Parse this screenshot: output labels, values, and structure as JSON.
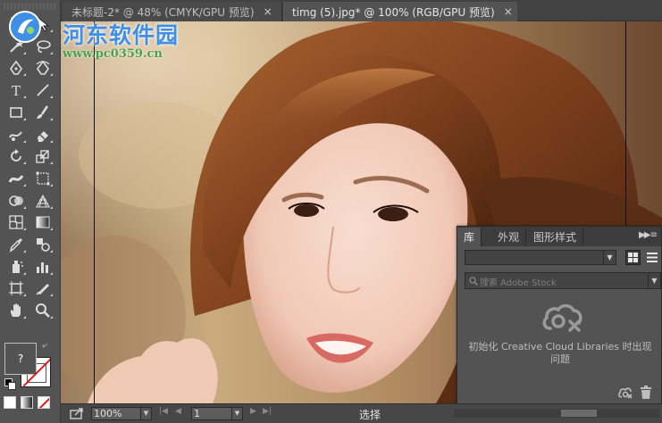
{
  "tabs": [
    {
      "label": "未标题-2* @ 48% (CMYK/GPU 预览)",
      "active": false
    },
    {
      "label": "timg (5).jpg* @ 100% (RGB/GPU 预览)",
      "active": true
    }
  ],
  "tab_close_glyph": "×",
  "watermark": {
    "title": "河东软件园",
    "url": "www.pc0359.cn"
  },
  "tools": [
    "selection-tool",
    "direct-selection-tool",
    "magic-wand-tool",
    "lasso-tool",
    "pen-tool",
    "curvature-tool",
    "type-tool",
    "line-tool",
    "rectangle-tool",
    "paintbrush-tool",
    "shaper-tool",
    "eraser-tool",
    "rotate-tool",
    "scale-tool",
    "width-tool",
    "free-transform-tool",
    "shape-builder-tool",
    "perspective-grid-tool",
    "mesh-tool",
    "gradient-tool",
    "eyedropper-tool",
    "blend-tool",
    "symbol-sprayer-tool",
    "column-graph-tool",
    "artboard-tool",
    "slice-tool",
    "hand-tool",
    "zoom-tool"
  ],
  "fill_swatch_label": "?",
  "panel": {
    "tabs": [
      "库",
      "外观",
      "图形样式"
    ],
    "search_placeholder": "搜索 Adobe Stock",
    "message": "初始化 Creative Cloud Libraries 时出现问题",
    "menu_glyph": "▶▶ ≡"
  },
  "status": {
    "zoom": "100%",
    "page": "1",
    "text": "选择"
  },
  "colors": {
    "accent": "#3f8fe6",
    "url_green": "#47a04a",
    "none_red": "#e01818"
  }
}
